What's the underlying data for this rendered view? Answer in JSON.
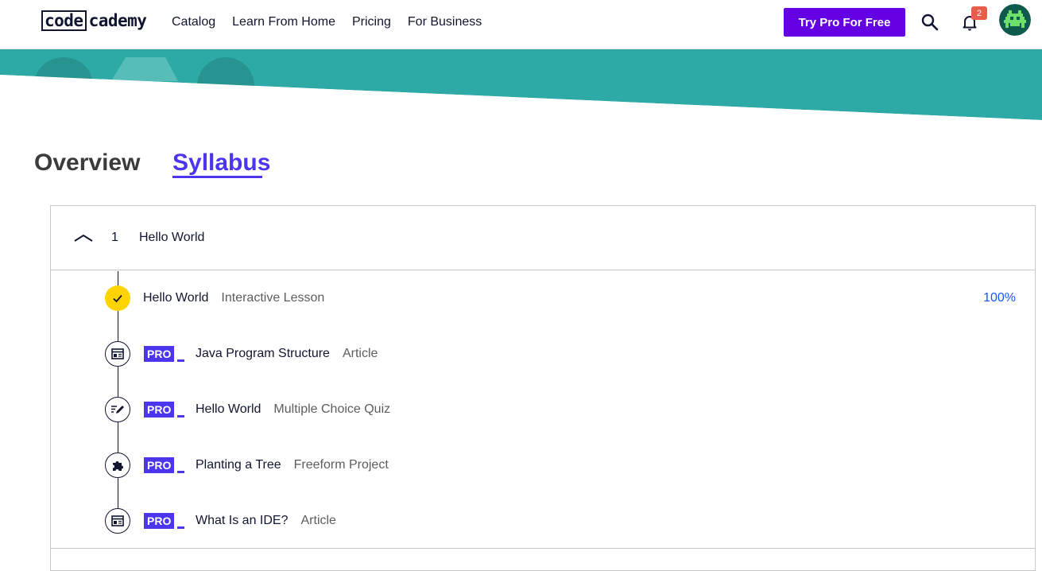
{
  "header": {
    "logo_boxed": "code",
    "logo_rest": "cademy",
    "nav": [
      "Catalog",
      "Learn From Home",
      "Pricing",
      "For Business"
    ],
    "cta_label": "Try Pro For Free",
    "notification_count": "2",
    "accent_color": "#6400e4"
  },
  "tabs": {
    "overview": "Overview",
    "syllabus": "Syllabus"
  },
  "module": {
    "number": "1",
    "title": "Hello World",
    "items": [
      {
        "title": "Hello World",
        "type": "Interactive Lesson",
        "pro": false,
        "completed": true,
        "progress": "100%",
        "icon": "check-icon"
      },
      {
        "title": "Java Program Structure",
        "type": "Article",
        "pro": true,
        "completed": false,
        "icon": "article-icon"
      },
      {
        "title": "Hello World",
        "type": "Multiple Choice Quiz",
        "pro": true,
        "completed": false,
        "icon": "quiz-icon"
      },
      {
        "title": "Planting a Tree",
        "type": "Freeform Project",
        "pro": true,
        "completed": false,
        "icon": "puzzle-icon"
      },
      {
        "title": "What Is an IDE?",
        "type": "Article",
        "pro": true,
        "completed": false,
        "icon": "article-icon"
      }
    ]
  },
  "pro_label": "PRO",
  "colors": {
    "hero_teal": "#2eaaa6",
    "pro_blue": "#4b35ef",
    "progress_blue": "#1557ff",
    "completed_yellow": "#ffd300"
  }
}
